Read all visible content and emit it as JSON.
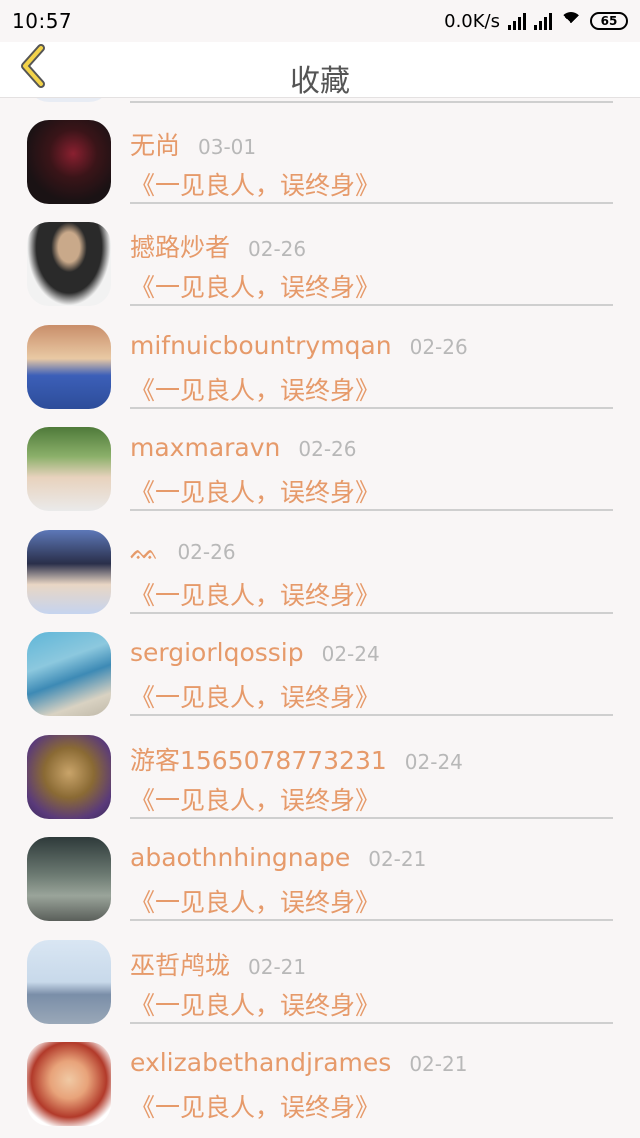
{
  "status": {
    "time": "10:57",
    "speed": "0.0K/s",
    "battery": "65"
  },
  "header": {
    "title": "收藏",
    "back_icon": "chevron-left-icon"
  },
  "items": [
    {
      "name": "无尚",
      "date": "03-01",
      "message": "《一见良人，误终身》"
    },
    {
      "name": "撼路炒者",
      "date": "02-26",
      "message": "《一见良人，误终身》"
    },
    {
      "name": "mifnuicbountrymqan",
      "date": "02-26",
      "message": "《一见良人，误终身》"
    },
    {
      "name": "maxmaravn",
      "date": "02-26",
      "message": "《一见良人，误终身》"
    },
    {
      "name": "ᨐ",
      "date": "02-26",
      "message": "《一见良人，误终身》"
    },
    {
      "name": "sergiorlqossip",
      "date": "02-24",
      "message": "《一见良人，误终身》"
    },
    {
      "name": "游客1565078773231",
      "date": "02-24",
      "message": "《一见良人，误终身》"
    },
    {
      "name": "abaothnhingnape",
      "date": "02-21",
      "message": "《一见良人，误终身》"
    },
    {
      "name": "巫哲鸬垅",
      "date": "02-21",
      "message": "《一见良人，误终身》"
    },
    {
      "name": "exlizabethandjrames",
      "date": "02-21",
      "message": "《一见良人，误终身》"
    }
  ]
}
